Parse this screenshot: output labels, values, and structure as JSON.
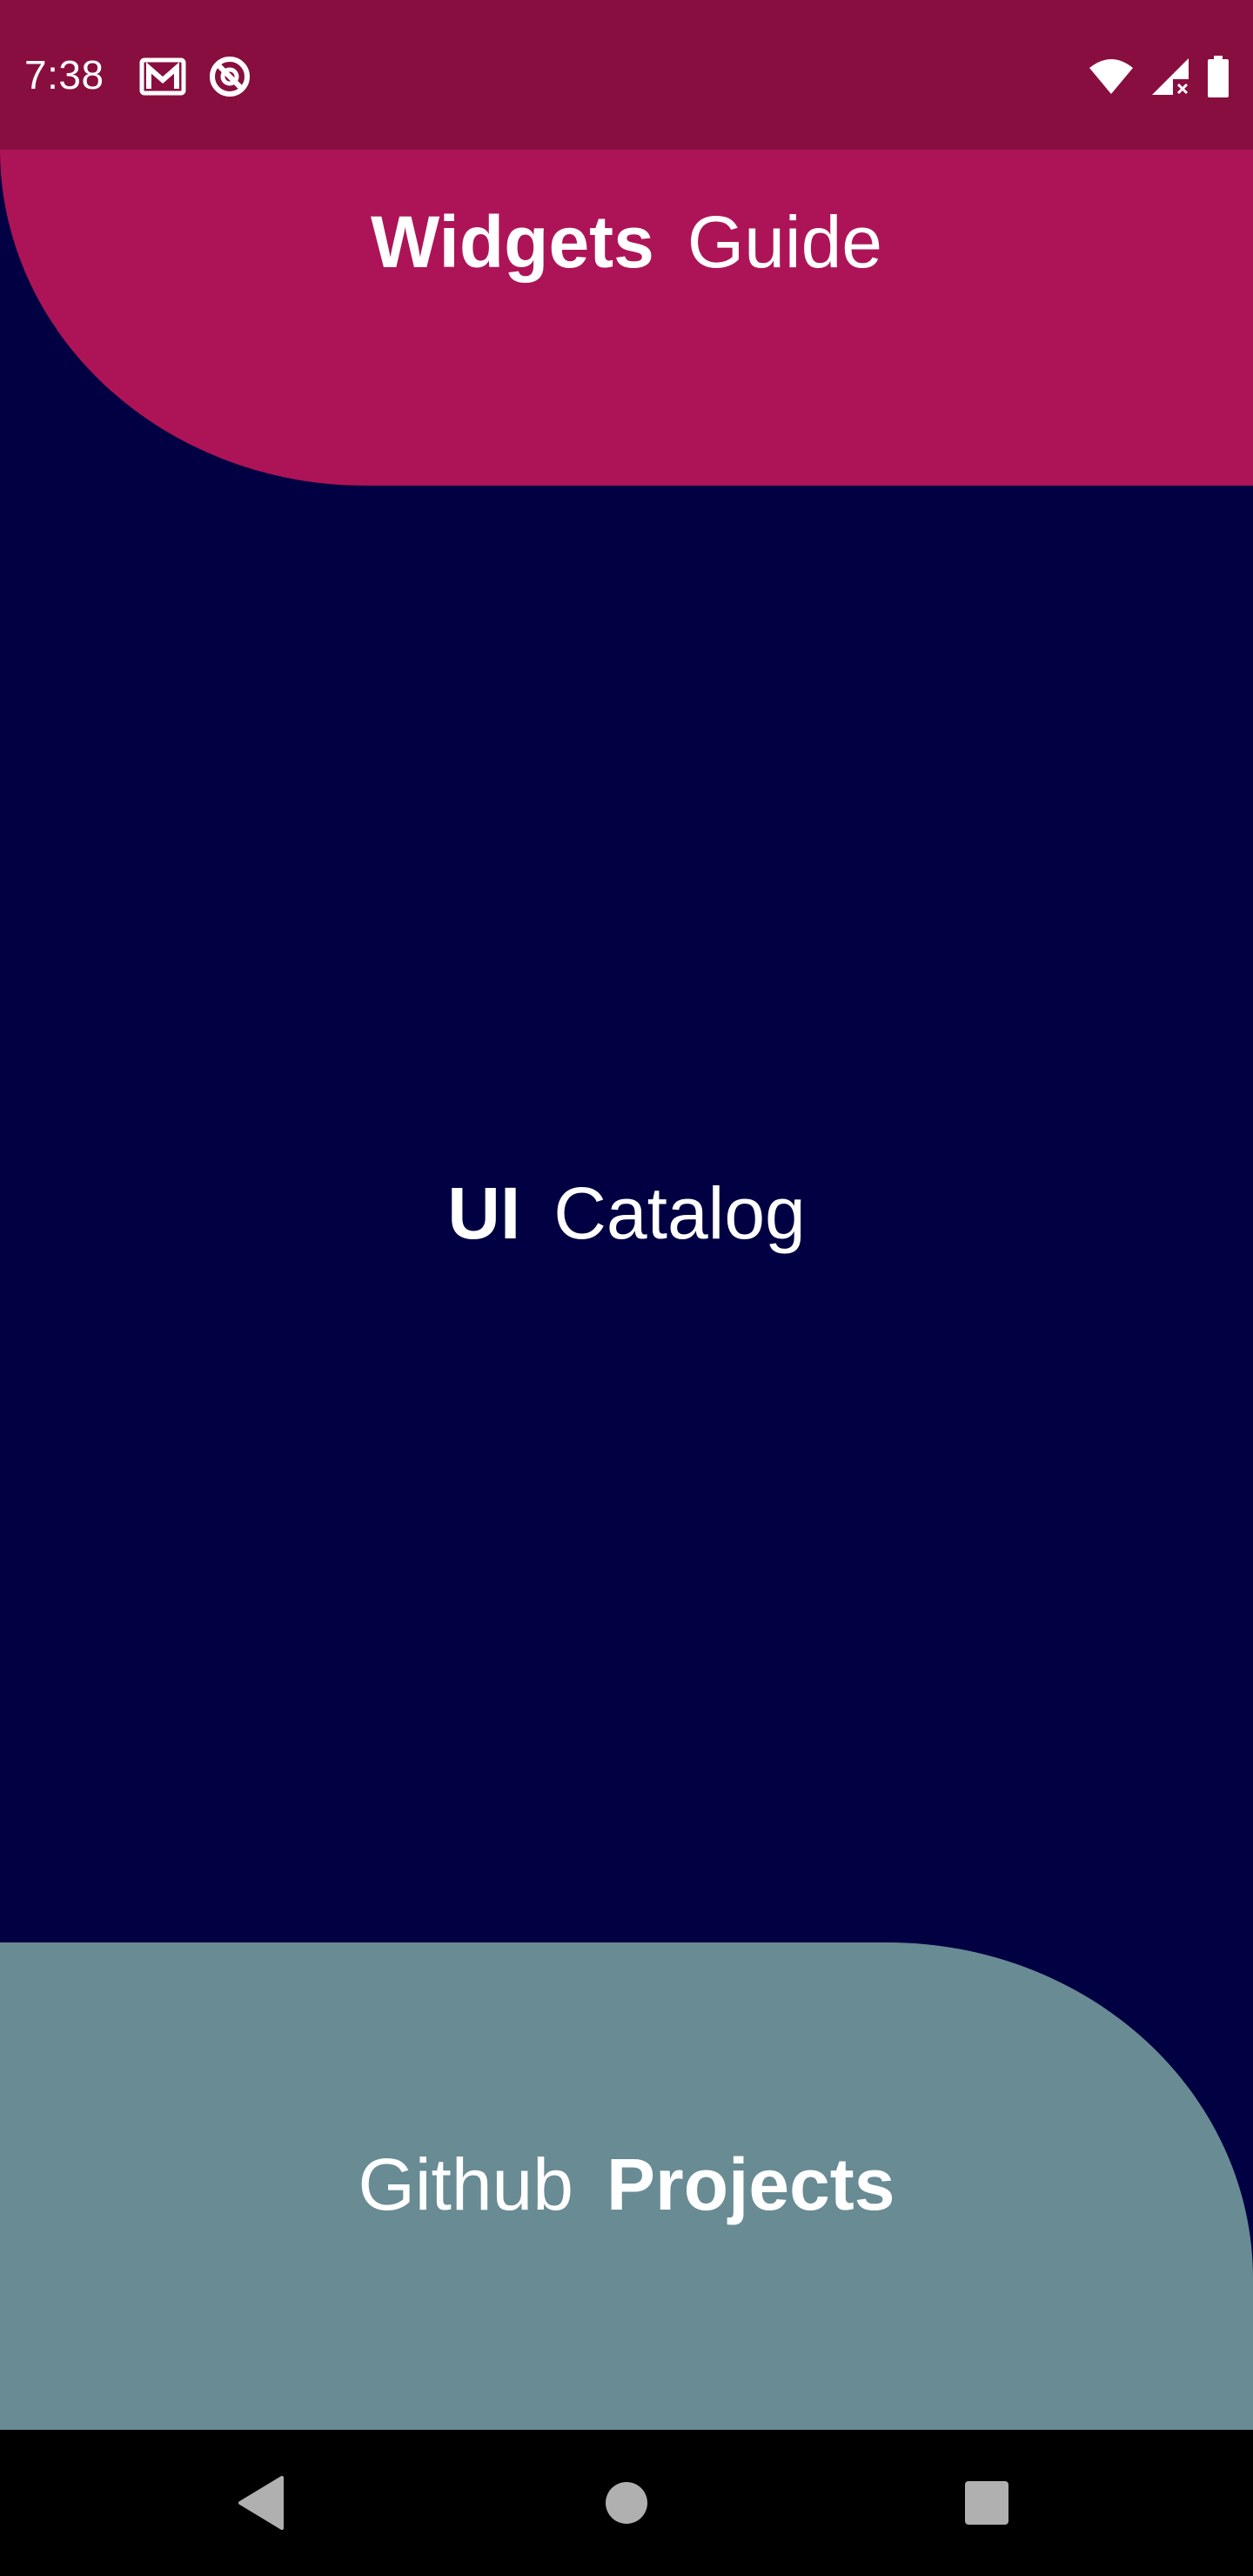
{
  "status_bar": {
    "time": "7:38",
    "left_icons": [
      "gmail-icon",
      "sync-off-icon"
    ],
    "right_icons": [
      "wifi-icon",
      "signal-no-data-icon",
      "battery-icon"
    ]
  },
  "cards": {
    "top": {
      "bold_text": "Widgets",
      "regular_text": "Guide",
      "color": "#ad1457"
    },
    "middle": {
      "bold_text": "UI",
      "regular_text": "Catalog",
      "color": "#000042"
    },
    "bottom": {
      "regular_text": "Github",
      "bold_text": "Projects",
      "color": "#688b94"
    }
  },
  "nav_bar": {
    "buttons": [
      "back-icon",
      "home-icon",
      "recents-icon"
    ]
  },
  "colors": {
    "status_bar": "#880e3f",
    "nav_bar": "#000000",
    "text": "#ffffff"
  }
}
